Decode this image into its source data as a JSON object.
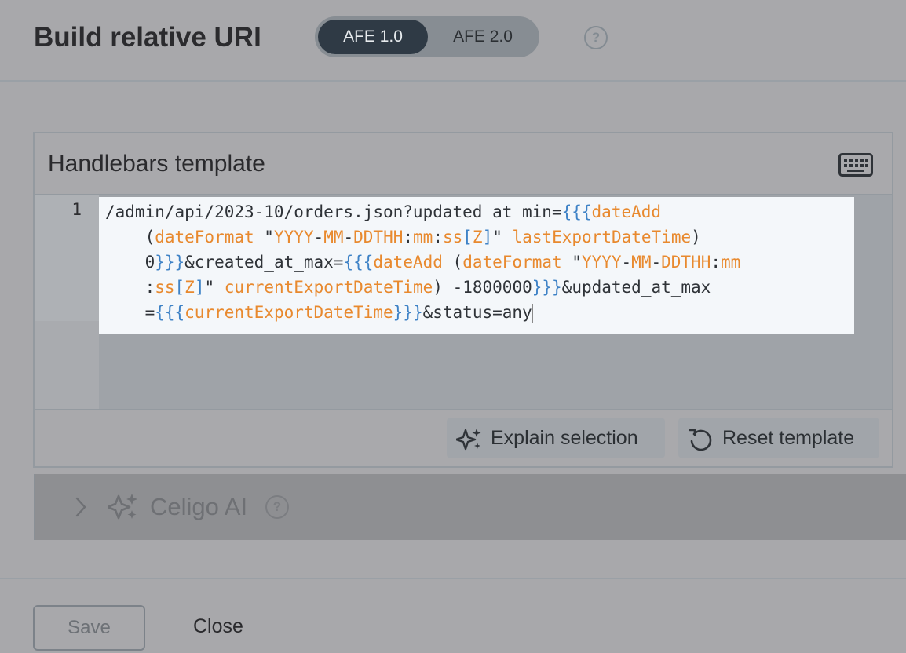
{
  "header": {
    "title": "Build relative URI",
    "toggle": {
      "options": [
        "AFE 1.0",
        "AFE 2.0"
      ],
      "selected": "AFE 1.0"
    },
    "help": "?"
  },
  "editor": {
    "title": "Handlebars template",
    "line_number": "1",
    "code_lines": [
      "/admin/api/2023-10/orders.json?updated_at_min={{{dateAdd",
      "    (dateFormat \"YYYY-MM-DDTHH:mm:ss[Z]\" lastExportDateTime)",
      "    0}}}&created_at_max={{{dateAdd (dateFormat \"YYYY-MM-DDTHH:mm",
      "    :ss[Z]\" currentExportDateTime) -1800000}}}&updated_at_max",
      "    ={{{currentExportDateTime}}}&status=any"
    ],
    "explain_label": "Explain selection",
    "reset_label": "Reset template"
  },
  "ai": {
    "label": "Celigo AI",
    "help": "?"
  },
  "footer": {
    "save_label": "Save",
    "close_label": "Close"
  },
  "colors": {
    "brace": "#3e82c6",
    "helper": "#e8892e",
    "selected_toggle": "#2f3a45"
  }
}
